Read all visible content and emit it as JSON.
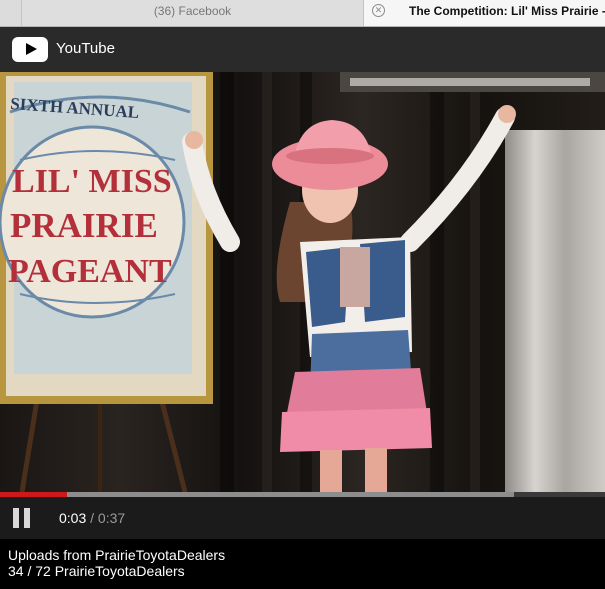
{
  "browser": {
    "tabs": [
      {
        "title": "(36) Facebook",
        "active": false
      },
      {
        "title": "The Competition: Lil' Miss Prairie -",
        "active": true
      }
    ]
  },
  "youtube": {
    "brand": "YouTube"
  },
  "video": {
    "sign_lines": [
      "SIXTH ANNUAL",
      "LIL' MISS",
      "PRAIRIE",
      "PAGEANT"
    ],
    "progress_played": 0.11,
    "progress_buffered": 0.85
  },
  "player": {
    "current_time": "0:03",
    "separator": "/",
    "duration": "0:37"
  },
  "info": {
    "playlist": "Uploads from PrairieToyotaDealers",
    "position": "34 / 72",
    "channel": "PrairieToyotaDealers"
  },
  "colors": {
    "progress_played": "#cc1a1a",
    "header_bg": "#2a2a2a",
    "controls_bg": "#1b1b1b"
  }
}
